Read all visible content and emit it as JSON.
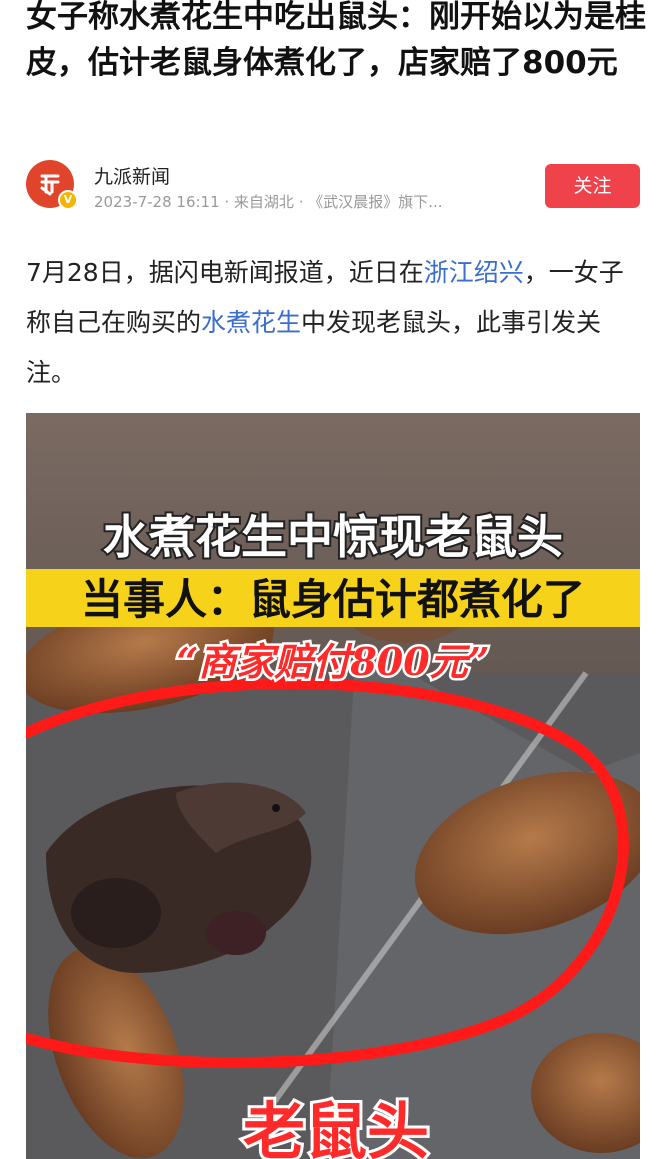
{
  "article": {
    "title": "女子称水煮花生中吃出鼠头：刚开始以为是桂皮，估计老鼠身体煮化了，店家赔了800元"
  },
  "author": {
    "name": "九派新闻",
    "avatar_icon": "jiupai-logo-icon",
    "verified_icon": "verified-v-icon",
    "meta": "2023-7-28 16:11 · 来自湖北 · 《武汉晨报》旗下..."
  },
  "follow": {
    "label": "关注",
    "color": "#f0424a"
  },
  "body": {
    "p1_a": "7月28日，据闪电新闻报道，近日在",
    "p1_link1": "浙江绍兴",
    "p1_b": "，一女子称自己在购买的",
    "p1_link2": "水煮花生",
    "p1_c": "中发现老鼠头，此事引发关注。",
    "link_color": "#3a6ecf"
  },
  "image": {
    "caption_main": "水煮花生中惊现老鼠头",
    "caption_sub": "当事人：鼠身估计都煮化了",
    "caption_quote": "“商家赔付800元”",
    "caption_bottom": "老鼠头",
    "banner_color": "#f7d21a",
    "circle_color": "#ff1a1a"
  }
}
